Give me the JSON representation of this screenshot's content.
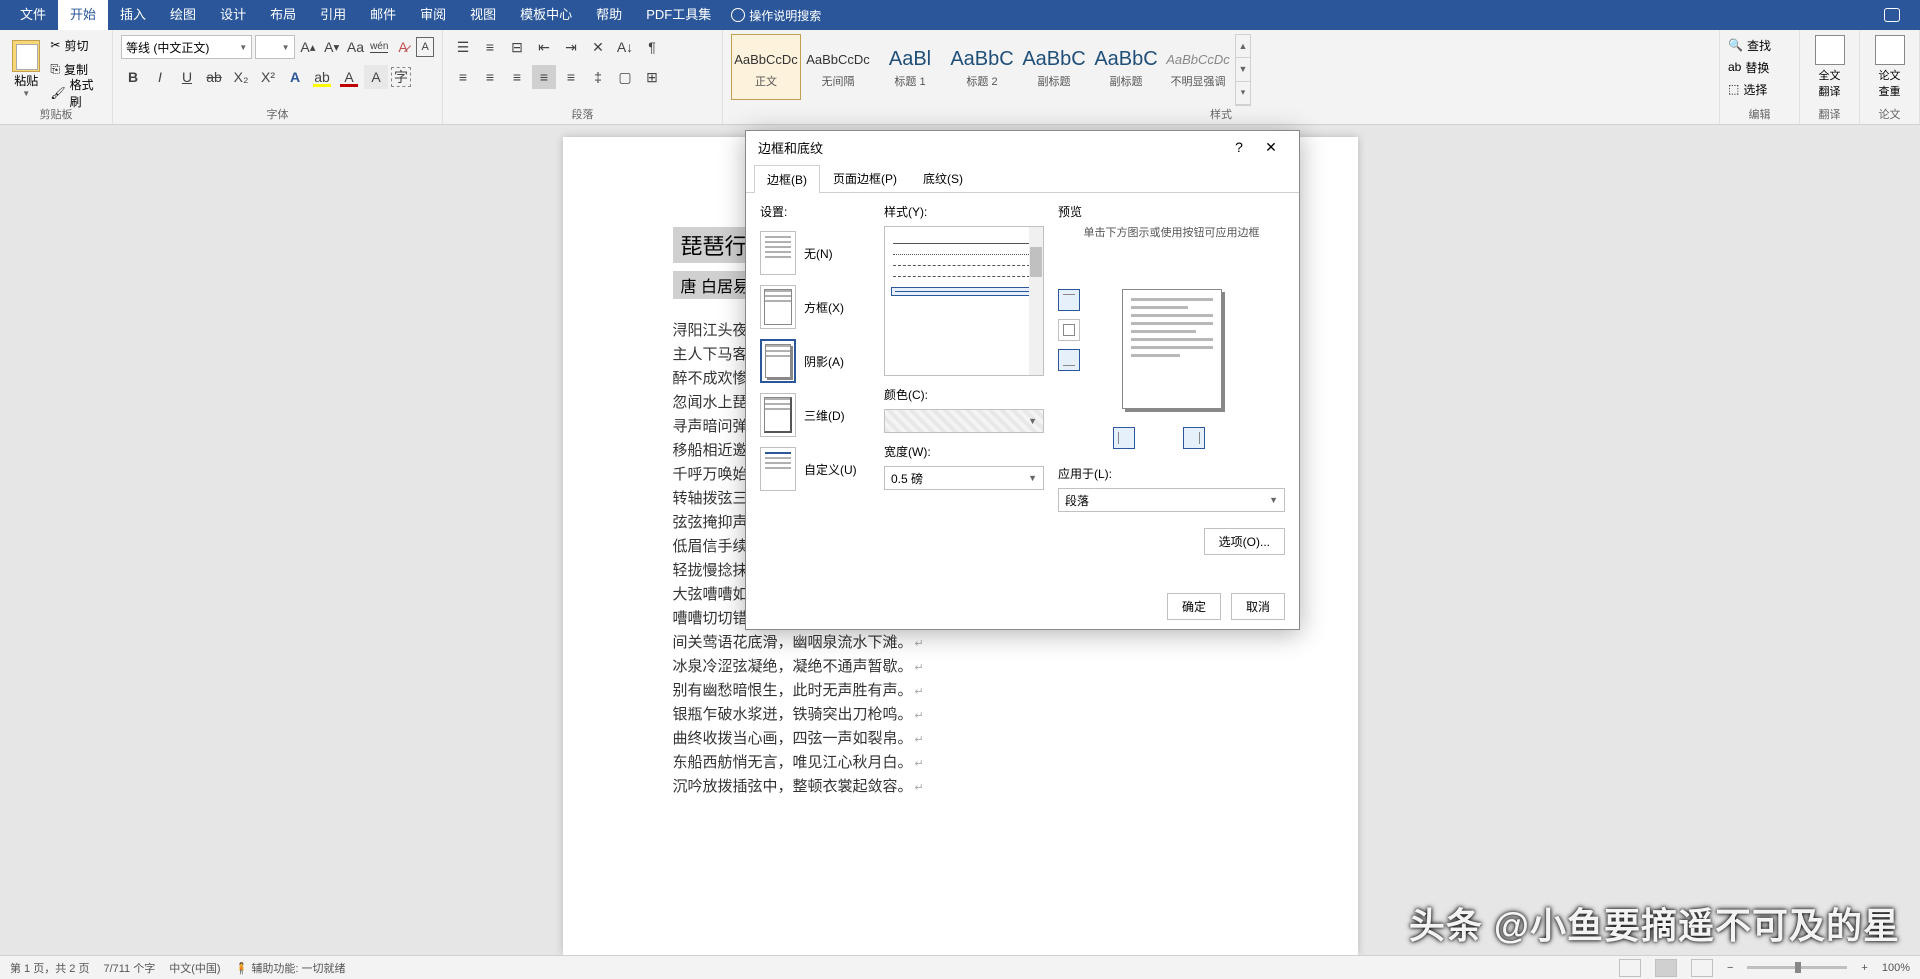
{
  "menubar": {
    "items": [
      "文件",
      "开始",
      "插入",
      "绘图",
      "设计",
      "布局",
      "引用",
      "邮件",
      "审阅",
      "视图",
      "模板中心",
      "帮助",
      "PDF工具集"
    ],
    "active_index": 1,
    "tell_me": "操作说明搜索"
  },
  "ribbon": {
    "clipboard": {
      "label": "剪贴板",
      "paste": "粘贴",
      "cut": "剪切",
      "copy": "复制",
      "format_painter": "格式刷"
    },
    "font": {
      "label": "字体",
      "font_name": "等线 (中文正文)",
      "font_size": ""
    },
    "paragraph": {
      "label": "段落"
    },
    "styles": {
      "label": "样式",
      "items": [
        {
          "preview": "AaBbCcDc",
          "name": "正文",
          "active": true
        },
        {
          "preview": "AaBbCcDc",
          "name": "无间隔",
          "active": false
        },
        {
          "preview": "AaBl",
          "name": "标题 1",
          "active": false,
          "big": true
        },
        {
          "preview": "AaBbC",
          "name": "标题 2",
          "active": false,
          "big": true
        },
        {
          "preview": "AaBbC",
          "name": "副标题",
          "active": false,
          "big": true
        },
        {
          "preview": "AaBbC",
          "name": "副标题",
          "active": false,
          "big": true
        },
        {
          "preview": "AaBbCcDc",
          "name": "不明显强调",
          "active": false
        }
      ]
    },
    "editing": {
      "label": "编辑",
      "find": "查找",
      "replace": "替换",
      "select": "选择"
    },
    "translate": {
      "label": "翻译",
      "btn": "全文\n翻译"
    },
    "paper": {
      "label": "论文",
      "btn": "论文\n查重"
    }
  },
  "document": {
    "title": "琵琶行",
    "author": "唐  白居易",
    "lines": [
      "浔阳江头夜送客，枫叶荻花秋瑟瑟。",
      "主人下马客在船，举酒欲饮无管弦。",
      "醉不成欢惨将别，别时茫茫江浸月。",
      "忽闻水上琵琶声，主人忘归客不发。",
      "寻声暗问弹者谁，琵琶声停欲语迟。",
      "移船相近邀相见，添酒回灯重开宴。",
      "千呼万唤始出来，犹抱琵琶半遮面。",
      "转轴拨弦三两声，未成曲调先有情。",
      "弦弦掩抑声声思，似诉平生不得志。",
      "低眉信手续续弹，说尽心中无限事。",
      "轻拢慢捻抹复挑，初为霓裳后六幺。",
      "大弦嘈嘈如急雨，小弦切切如私语。",
      "嘈嘈切切错杂弹，大珠小珠落玉盘。",
      "间关莺语花底滑，幽咽泉流水下滩。",
      "冰泉冷涩弦凝绝，凝绝不通声暂歇。",
      "别有幽愁暗恨生，此时无声胜有声。",
      "银瓶乍破水浆迸，铁骑突出刀枪鸣。",
      "曲终收拨当心画，四弦一声如裂帛。",
      "东船西舫悄无言，唯见江心秋月白。",
      "沉吟放拨插弦中，整顿衣裳起敛容。"
    ]
  },
  "dialog": {
    "title": "边框和底纹",
    "tabs": [
      "边框(B)",
      "页面边框(P)",
      "底纹(S)"
    ],
    "active_tab": 0,
    "settings_label": "设置:",
    "settings": [
      {
        "key": "none",
        "label": "无(N)"
      },
      {
        "key": "box",
        "label": "方框(X)"
      },
      {
        "key": "shadow",
        "label": "阴影(A)",
        "selected": true
      },
      {
        "key": "threed",
        "label": "三维(D)"
      },
      {
        "key": "custom",
        "label": "自定义(U)"
      }
    ],
    "style_label": "样式(Y):",
    "color_label": "颜色(C):",
    "color_value": "",
    "width_label": "宽度(W):",
    "width_value": "0.5 磅",
    "preview_label": "预览",
    "preview_hint": "单击下方图示或使用按钮可应用边框",
    "apply_label": "应用于(L):",
    "apply_value": "段落",
    "options_btn": "选项(O)...",
    "ok": "确定",
    "cancel": "取消"
  },
  "statusbar": {
    "page": "第 1 页，共 2 页",
    "words": "7/711 个字",
    "lang": "中文(中国)",
    "a11y": "辅助功能: 一切就绪",
    "zoom": "100%"
  },
  "watermark": "头条 @小鱼要摘遥不可及的星"
}
